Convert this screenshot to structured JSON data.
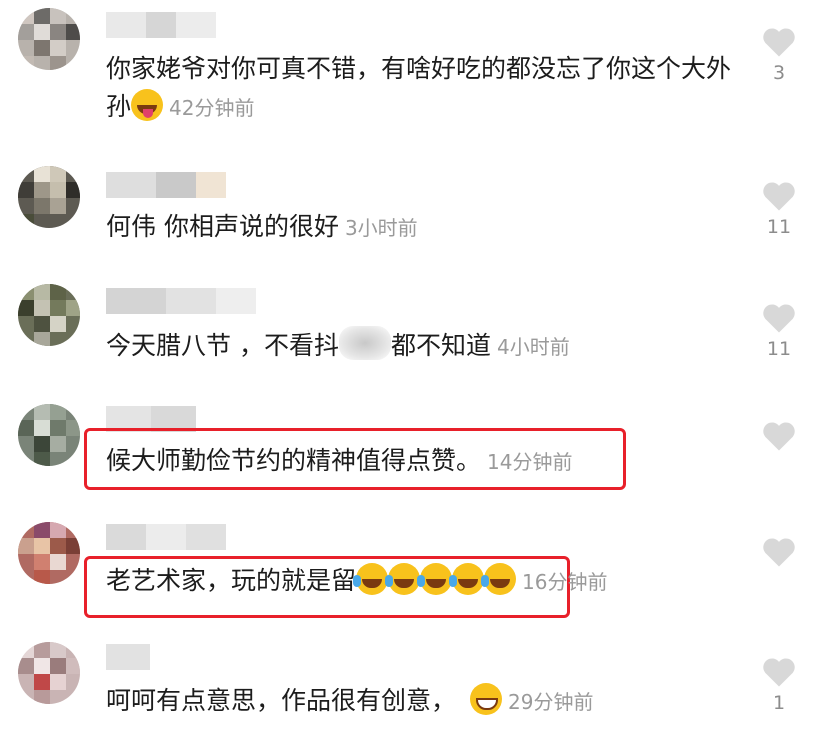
{
  "comments": [
    {
      "text": "你家姥爷对你可真不错，有啥好吃的都没忘了你这个大外孙",
      "time": "42分钟前",
      "likes": "3"
    },
    {
      "text": "何伟 你相声说的很好",
      "time": "3小时前",
      "likes": "11"
    },
    {
      "text_before": "今天腊八节 ，不看抖",
      "text_after": "都不知道",
      "time": "4小时前",
      "likes": "11"
    },
    {
      "text": "候大师勤俭节约的精神值得点赞。",
      "time": "14分钟前",
      "likes": ""
    },
    {
      "text": "老艺术家，玩的就是留",
      "time": "16分钟前",
      "likes": ""
    },
    {
      "text": "呵呵有点意思，作品很有创意，",
      "time": "29分钟前",
      "likes": "1"
    }
  ],
  "colors": {
    "highlight": "#e8202a",
    "heart": "#d8d8d8",
    "time": "#9a9a9a"
  },
  "icons": {
    "like": "heart-icon"
  }
}
